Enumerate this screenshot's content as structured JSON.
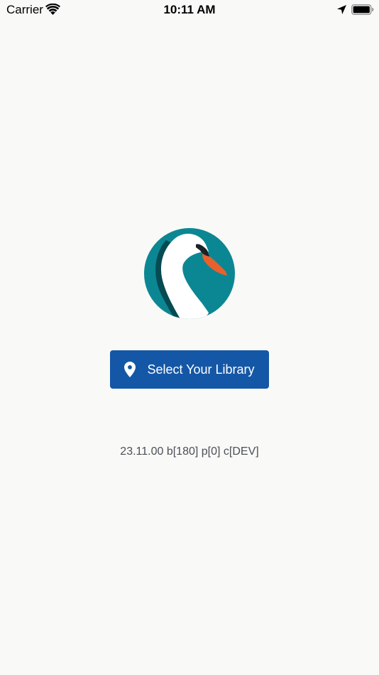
{
  "status_bar": {
    "carrier": "Carrier",
    "time": "10:11 AM",
    "icons": [
      "wifi-icon",
      "location-arrow-icon",
      "battery-icon"
    ]
  },
  "logo": {
    "icon": "swan-logo",
    "colors": {
      "teal": "#0b8793",
      "dark_teal": "#064a52",
      "white": "#ffffff",
      "beak": "#e8612c"
    }
  },
  "main": {
    "select_library_label": "Select Your Library",
    "select_library_icon": "map-pin-icon",
    "version": "23.11.00 b[180] p[0] c[DEV]"
  },
  "colors": {
    "background": "#f9f9f7",
    "button": "#1457a6",
    "button_text": "#ffffff",
    "version_text": "#4b4f57"
  }
}
